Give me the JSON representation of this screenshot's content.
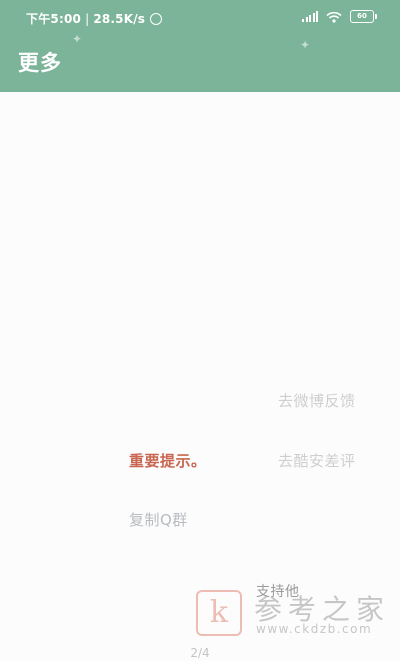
{
  "status_bar": {
    "time": "下午5:00",
    "network_speed": "28.5K/s",
    "battery_level": "60",
    "icons": [
      "alarm-icon",
      "signal-icon",
      "wifi-icon",
      "battery-icon"
    ]
  },
  "header": {
    "title": "更多",
    "background_color": "#7cb49a"
  },
  "menu": {
    "weibo_feedback": "去微博反馈",
    "important_notice": "重要提示。",
    "coolapk_review": "去酷安差评",
    "copy_qq_group": "复制Q群",
    "support_him": "支持他"
  },
  "pager": {
    "indicator": "2/4"
  },
  "watermark": {
    "logo_letter": "k",
    "site_name": "参考之家",
    "url": "www.ckdzb.com"
  },
  "colors": {
    "accent": "#7cb49a",
    "notice": "#c8664f",
    "muted_text": "#cfcfcf"
  }
}
